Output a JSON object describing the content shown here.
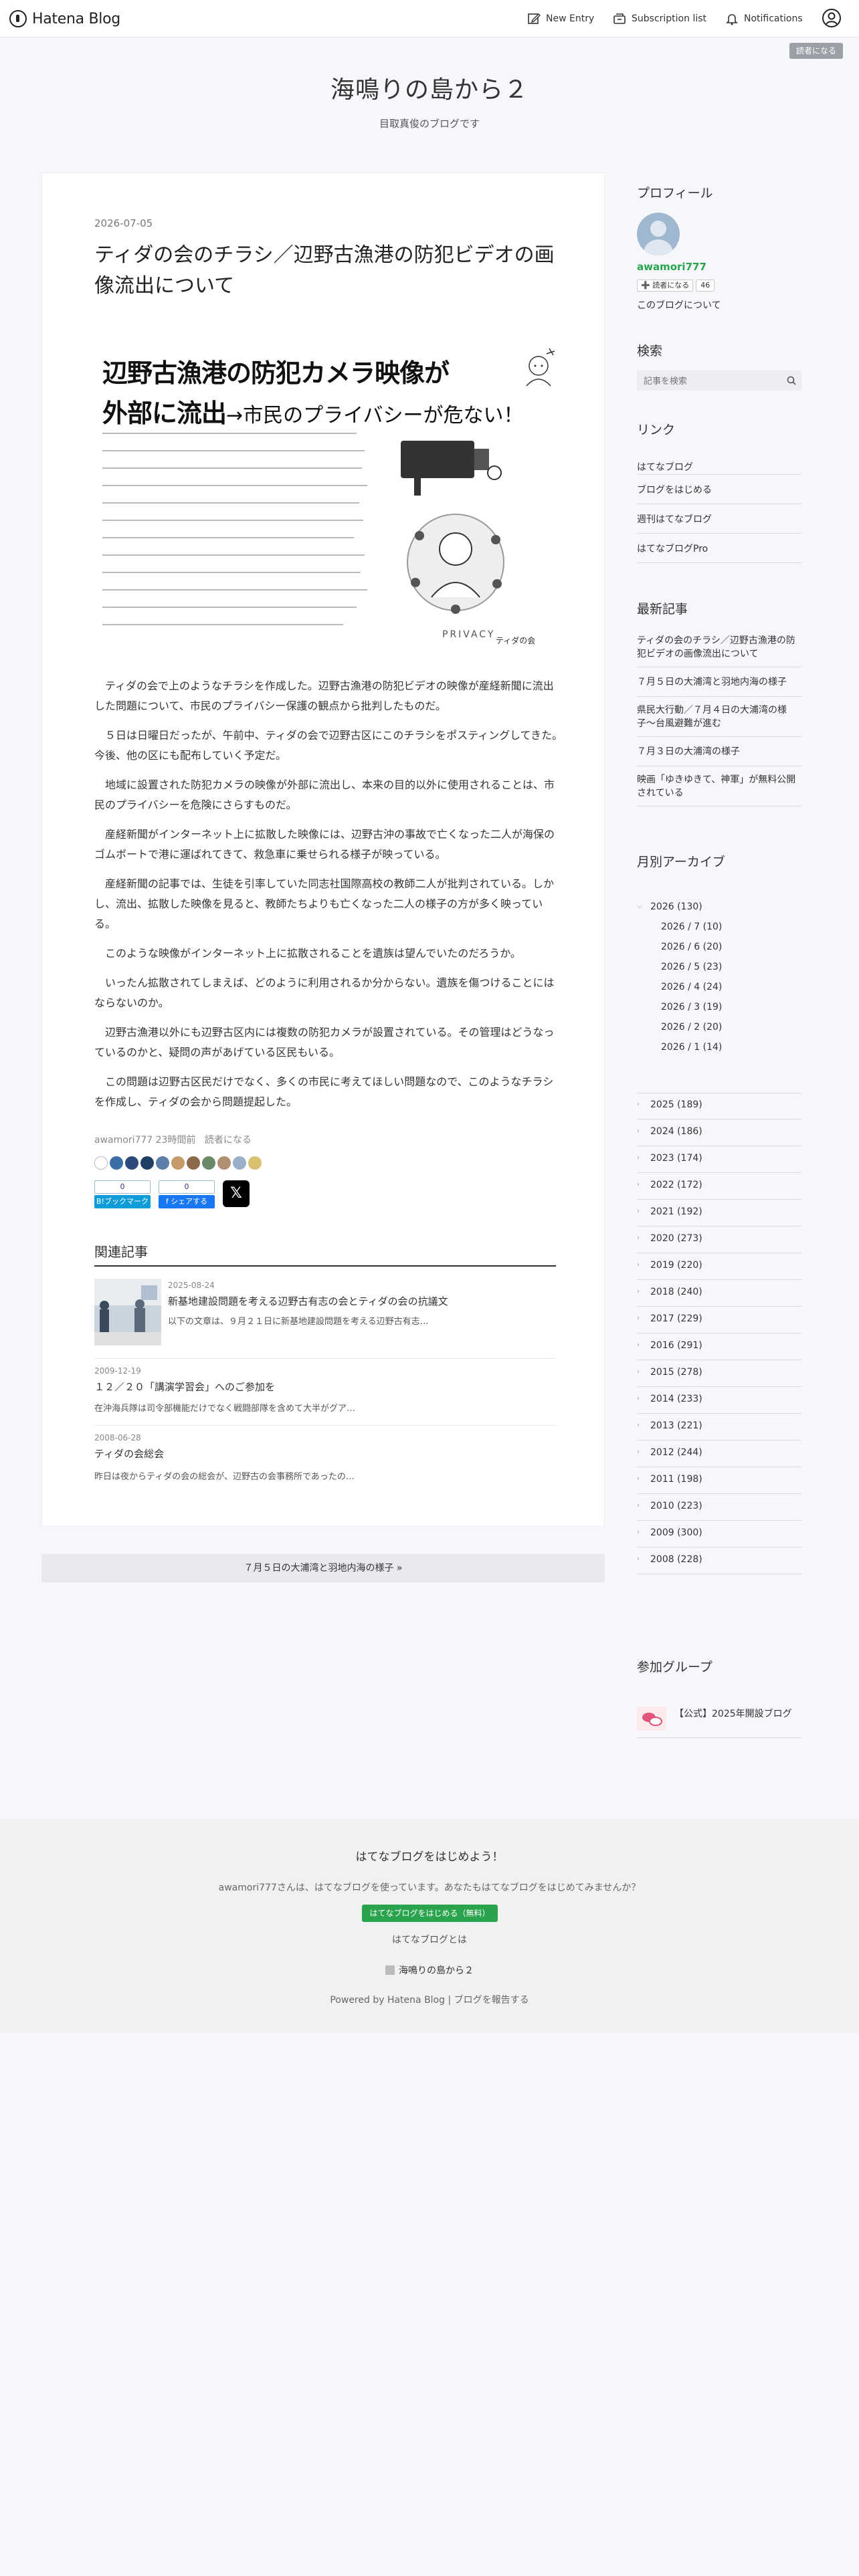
{
  "header": {
    "logo": "Hatena Blog",
    "new_entry": "New Entry",
    "subscription_list": "Subscription list",
    "notifications": "Notifications",
    "reader_badge": "読者になる"
  },
  "blog": {
    "title": "海鳴りの島から２",
    "description": "目取真俊のブログです"
  },
  "entry": {
    "date": "2026-07-05",
    "title": "ティダの会のチラシ／辺野古漁港の防犯ビデオの画像流出について",
    "flyer": {
      "headline1": "辺野古漁港の防犯カメラ映像が",
      "headline2_main": "外部に流出",
      "headline2_sub": "→市民のプライバシーが危ない！",
      "art_label": "PRIVACY",
      "signature": "ティダの会"
    },
    "paragraphs": [
      "ティダの会で上のようなチラシを作成した。辺野古漁港の防犯ビデオの映像が産経新聞に流出した問題について、市民のプライバシー保護の観点から批判したものだ。",
      "５日は日曜日だったが、午前中、ティダの会で辺野古区にこのチラシをポスティングしてきた。今後、他の区にも配布していく予定だ。",
      "地域に設置された防犯カメラの映像が外部に流出し、本来の目的以外に使用されることは、市民のプライバシーを危険にさらすものだ。",
      "産経新聞がインターネット上に拡散した映像には、辺野古沖の事故で亡くなった二人が海保のゴムボートで港に運ばれてきて、救急車に乗せられる様子が映っている。",
      "産経新聞の記事では、生徒を引率していた同志社国際高校の教師二人が批判されている。しかし、流出、拡散した映像を見ると、教師たちよりも亡くなった二人の様子の方が多く映っている。",
      "このような映像がインターネット上に拡散されることを遺族は望んでいたのだろうか。",
      "いったん拡散されてしまえば、どのように利用されるか分からない。遺族を傷つけることにはならないのか。",
      "辺野古漁港以外にも辺野古区内には複数の防犯カメラが設置されている。その管理はどうなっているのかと、疑問の声があげている区民もいる。",
      "この問題は辺野古区民だけでなく、多くの市民に考えてほしい問題なので、このようなチラシを作成し、ティダの会から問題提起した。"
    ],
    "byline_author": "awamori777",
    "byline_time": "23時間前",
    "byline_reader": "読者になる",
    "share": {
      "hatena_count": "0",
      "hatena_label": "B!ブックマーク",
      "fb_count": "0",
      "fb_label": "f シェアする",
      "x_label": "𝕏"
    }
  },
  "related": {
    "heading": "関連記事",
    "items": [
      {
        "date": "2025-08-24",
        "title": "新基地建設問題を考える辺野古有志の会とティダの会の抗議文",
        "snippet": "以下の文章は、９月２１日に新基地建設問題を考える辺野古有志…"
      },
      {
        "date": "2009-12-19",
        "title": "１２／２０「講演学習会」へのご参加を",
        "snippet": "在沖海兵隊は司令部機能だけでなく戦闘部隊を含めて大半がグア…"
      },
      {
        "date": "2008-06-28",
        "title": "ティダの会総会",
        "snippet": "昨日は夜からティダの会の総会が、辺野古の会事務所であったの…"
      }
    ]
  },
  "pager": {
    "next": "７月５日の大浦湾と羽地内海の様子 »"
  },
  "sidebar": {
    "profile_h": "プロフィール",
    "profile_name": "awamori777",
    "reader_button": "➕ 読者になる",
    "reader_count": "46",
    "about": "このブログについて",
    "search_h": "検索",
    "search_placeholder": "記事を検索",
    "links_h": "リンク",
    "links": [
      "はてなブログ",
      "ブログをはじめる",
      "週刊はてなブログ",
      "はてなブログPro"
    ],
    "recent_h": "最新記事",
    "recent": [
      "ティダの会のチラシ／辺野古漁港の防犯ビデオの画像流出について",
      "７月５日の大浦湾と羽地内海の様子",
      "県民大行動／７月４日の大浦湾の様子〜台風避難が進む",
      "７月３日の大浦湾の様子",
      "映画「ゆきゆきて、神軍」が無料公開されている"
    ],
    "archive_h": "月別アーカイブ",
    "archive_open": "2026 (130)",
    "archive_months": [
      "2026 / 7 (10)",
      "2026 / 6 (20)",
      "2026 / 5 (23)",
      "2026 / 4 (24)",
      "2026 / 3 (19)",
      "2026 / 2 (20)",
      "2026 / 1 (14)"
    ],
    "archive_years": [
      "2025 (189)",
      "2024 (186)",
      "2023 (174)",
      "2022 (172)",
      "2021 (192)",
      "2020 (273)",
      "2019 (220)",
      "2018 (240)",
      "2017 (229)",
      "2016 (291)",
      "2015 (278)",
      "2014 (233)",
      "2013 (221)",
      "2012 (244)",
      "2011 (198)",
      "2010 (223)",
      "2009 (300)",
      "2008 (228)"
    ],
    "group_h": "参加グループ",
    "group_name": "【公式】2025年開設ブログ"
  },
  "footer": {
    "heading": "はてなブログをはじめよう！",
    "message": "awamori777さんは、はてなブログを使っています。あなたもはてなブログをはじめてみませんか？",
    "cta": "はてなブログをはじめる（無料）",
    "about_link": "はてなブログとは",
    "blog_name": "海鳴りの島から２",
    "powered": "Powered by Hatena Blog | ブログを報告する"
  },
  "colors": {
    "accent": "#2aa34d",
    "page_bg": "#f6f7fa"
  }
}
